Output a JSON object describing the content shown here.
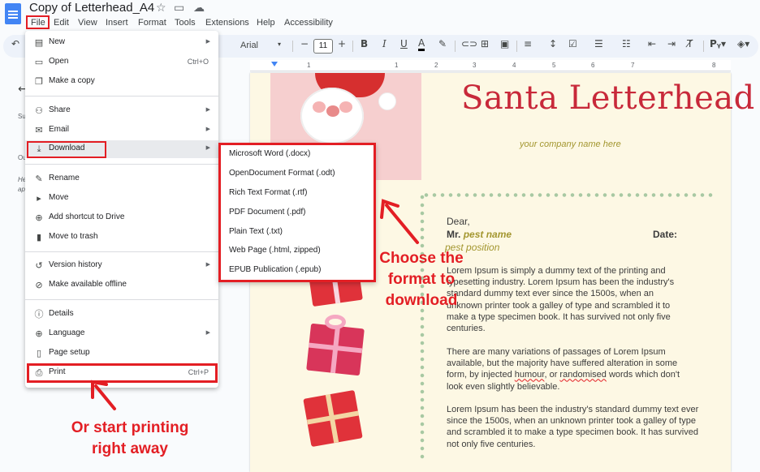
{
  "window": {
    "doc_title": "Copy of Letterhead_A4"
  },
  "menubar": {
    "items": [
      "File",
      "Edit",
      "View",
      "Insert",
      "Format",
      "Tools",
      "Extensions",
      "Help",
      "Accessibility"
    ]
  },
  "toolbar": {
    "font_name": "Arial",
    "font_size": "11",
    "minus": "−",
    "plus": "+"
  },
  "ruler": {
    "numbers": [
      "1",
      "1",
      "2",
      "3",
      "4",
      "5",
      "6",
      "7",
      "8"
    ]
  },
  "left_panel": {
    "texts": [
      "Su",
      "Ou",
      "He",
      "ap"
    ]
  },
  "file_menu": {
    "items": [
      {
        "label": "New",
        "icon": "new-doc-icon",
        "glyph": "▤",
        "arrow": true
      },
      {
        "label": "Open",
        "icon": "folder-icon",
        "glyph": "▭",
        "shortcut": "Ctrl+O"
      },
      {
        "label": "Make a copy",
        "icon": "copy-icon",
        "glyph": "❐"
      },
      {
        "label": "Share",
        "icon": "share-icon",
        "glyph": "⚇",
        "arrow": true
      },
      {
        "label": "Email",
        "icon": "email-icon",
        "glyph": "✉",
        "arrow": true
      },
      {
        "label": "Download",
        "icon": "download-icon",
        "glyph": "⤓",
        "arrow": true
      },
      {
        "label": "Rename",
        "icon": "rename-icon",
        "glyph": "✎"
      },
      {
        "label": "Move",
        "icon": "move-icon",
        "glyph": "▸"
      },
      {
        "label": "Add shortcut to Drive",
        "icon": "shortcut-icon",
        "glyph": "⊕"
      },
      {
        "label": "Move to trash",
        "icon": "trash-icon",
        "glyph": "▮"
      },
      {
        "label": "Version history",
        "icon": "history-icon",
        "glyph": "↺",
        "arrow": true
      },
      {
        "label": "Make available offline",
        "icon": "offline-icon",
        "glyph": "⊘"
      },
      {
        "label": "Details",
        "icon": "info-icon",
        "glyph": "ⓘ"
      },
      {
        "label": "Language",
        "icon": "globe-icon",
        "glyph": "⊕",
        "arrow": true
      },
      {
        "label": "Page setup",
        "icon": "page-setup-icon",
        "glyph": "▯"
      },
      {
        "label": "Print",
        "icon": "print-icon",
        "glyph": "⎙",
        "shortcut": "Ctrl+P"
      }
    ]
  },
  "download_menu": {
    "items": [
      "Microsoft Word (.docx)",
      "OpenDocument Format (.odt)",
      "Rich Text Format (.rtf)",
      "PDF Document (.pdf)",
      "Plain Text (.txt)",
      "Web Page (.html, zipped)",
      "EPUB Publication (.epub)"
    ]
  },
  "document": {
    "title": "Santa Letterhead",
    "company": "your company name here",
    "dear": "Dear,",
    "mr_label": "Mr.",
    "mr_name": "pest name",
    "date_label": "Date:",
    "position": "pest position",
    "para1": "Lorem Ipsum is simply a dummy text of the printing and typesetting industry. Lorem Ipsum has been the industry's standard dummy text ever since the 1500s, when an unknown printer took a galley of type and scrambled it to make a type specimen book. It has survived not only five centuries.",
    "para2_a": "There are many variations of passages of Lorem Ipsum available, but the majority have suffered alteration in some form, by injected ",
    "para2_humour": "humour",
    "para2_b": ", or ",
    "para2_randomised": "randomised",
    "para2_c": " words which don't look even slightly believable.",
    "para3": "Lorem Ipsum has been the industry's standard dummy text ever since the 1500s, when an unknown printer took a galley of type and scrambled it to make a type specimen book. It has survived not only five centuries."
  },
  "annotations": {
    "format": "Choose the format to download",
    "print": "Or start printing right away"
  },
  "colors": {
    "highlight": "#e31e24",
    "title_red": "#c8293a",
    "gold": "#a3962f",
    "page": "#fdf8e4"
  }
}
